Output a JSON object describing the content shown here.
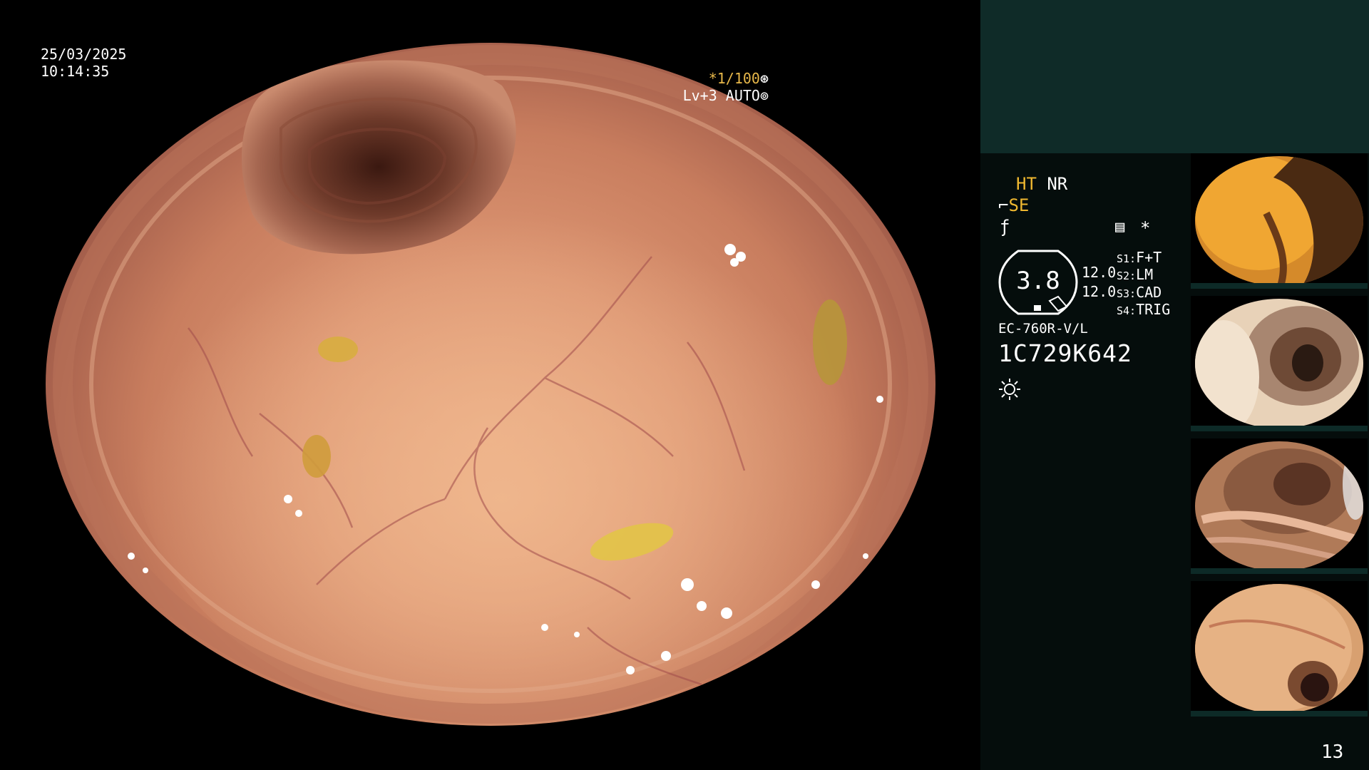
{
  "overlay": {
    "date": "25/03/2025",
    "time": "10:14:35",
    "shutter": "*1/100",
    "shutter_icon": "aperture-icon",
    "level": "Lv+3 AUTO",
    "level_icon": "iris-icon"
  },
  "panel": {
    "mode_ht": "HT",
    "mode_nr": "NR",
    "mode_se": "SE",
    "enhance_icon": "enhance-curve-icon",
    "record_icon": "record-icon",
    "star": "*",
    "gauge_value": "3.8",
    "value_a": "12.0",
    "value_b": "12.0",
    "switches": [
      {
        "label": "S1:",
        "value": "F+T"
      },
      {
        "label": "S2:",
        "value": "LM"
      },
      {
        "label": "S3:",
        "value": "CAD"
      },
      {
        "label": "S4:",
        "value": "TRIG"
      }
    ],
    "scope_model": "EC-760R-V/L",
    "scope_serial": "1C729K642",
    "light_icon": "light-source-icon",
    "page_number": "13"
  },
  "colors": {
    "accent_yellow": "#f0b830",
    "panel_top": "#0f2b28",
    "panel_body": "#050d0c",
    "text": "#ffffff"
  }
}
